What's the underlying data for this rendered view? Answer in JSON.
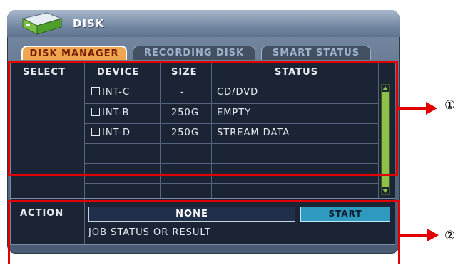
{
  "window": {
    "title": "DISK"
  },
  "tabs": [
    {
      "label": "DISK MANAGER",
      "active": true
    },
    {
      "label": "RECORDING DISK",
      "active": false
    },
    {
      "label": "SMART STATUS",
      "active": false
    }
  ],
  "table": {
    "columns": [
      "SELECT",
      "DEVICE",
      "SIZE",
      "STATUS"
    ],
    "rows": [
      {
        "device": "INT-C",
        "size": "-",
        "status": "CD/DVD"
      },
      {
        "device": "INT-B",
        "size": "250G",
        "status": "EMPTY"
      },
      {
        "device": "INT-D",
        "size": "250G",
        "status": "STREAM DATA"
      }
    ]
  },
  "action": {
    "label": "ACTION",
    "selected": "NONE",
    "start_label": "START",
    "job_status": "JOB STATUS OR RESULT"
  },
  "callouts": {
    "one": "①",
    "two": "②"
  },
  "colors": {
    "active_tab": "#f0a64e",
    "panel": "#1b2435",
    "start_button": "#2e9ac0",
    "annotation": "#e00000",
    "scrollbar": "#8ec14a"
  }
}
